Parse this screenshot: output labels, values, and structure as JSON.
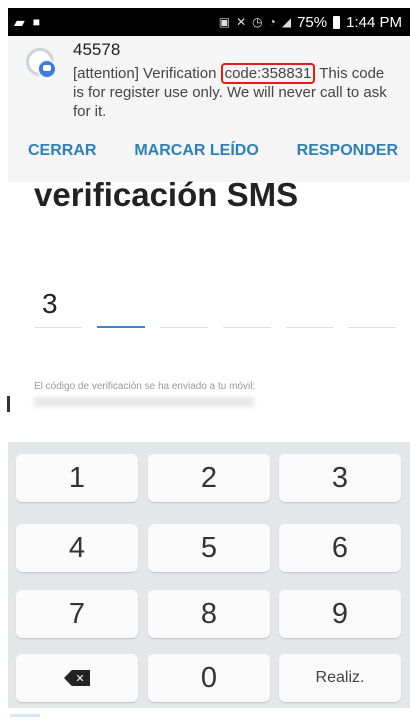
{
  "status_bar": {
    "battery": "75%",
    "time": "1:44 PM"
  },
  "notification": {
    "sender": "45578",
    "message_before": "[attention] Verification ",
    "message_code": "code:358831",
    "message_after": " This code is for register use only. We will never call to ask for it.",
    "actions": {
      "close": "CERRAR",
      "mark_read": "MARCAR LEÍDO",
      "reply": "RESPONDER"
    }
  },
  "main": {
    "title": "verificación SMS",
    "digits": [
      "3",
      "",
      "",
      "",
      "",
      ""
    ],
    "hint": "El código de verificación se ha enviado a tu móvil:"
  },
  "keypad": {
    "keys": [
      "1",
      "2",
      "3",
      "4",
      "5",
      "6",
      "7",
      "8",
      "9",
      "",
      "0",
      "Realiz."
    ]
  }
}
